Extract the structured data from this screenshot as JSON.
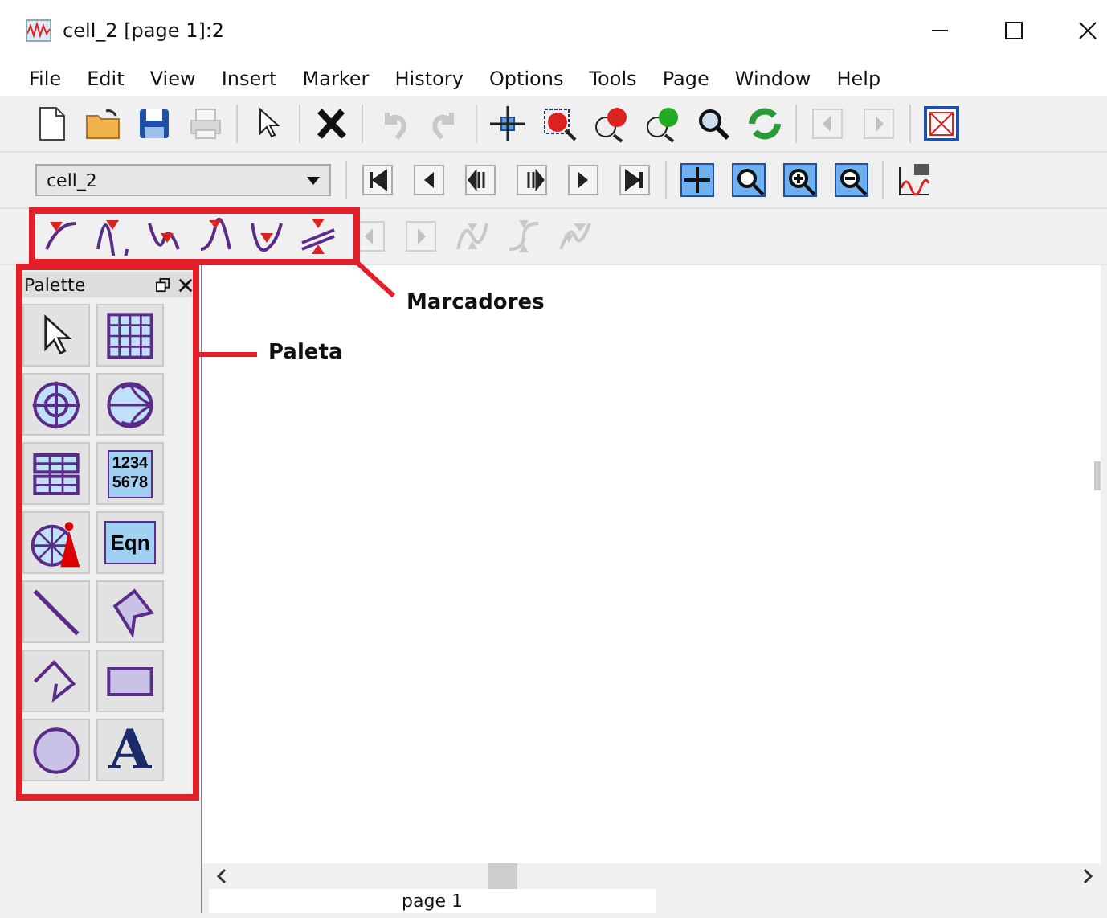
{
  "window": {
    "title": "cell_2 [page 1]:2"
  },
  "menu": [
    "File",
    "Edit",
    "View",
    "Insert",
    "Marker",
    "History",
    "Options",
    "Tools",
    "Page",
    "Window",
    "Help"
  ],
  "toolbar_main": [
    {
      "disabled": false
    },
    {
      "disabled": false
    },
    {
      "disabled": false
    },
    {
      "disabled": true
    },
    {
      "disabled": false
    },
    {
      "disabled": false
    },
    {
      "disabled": true
    },
    {
      "disabled": true
    },
    {
      "disabled": false
    },
    {
      "disabled": false
    },
    {
      "disabled": false
    },
    {
      "disabled": false
    },
    {
      "disabled": false
    },
    {
      "disabled": false
    },
    {
      "disabled": true
    },
    {
      "disabled": true
    },
    {
      "disabled": false
    }
  ],
  "toolbar_nav": {
    "cell_select": {
      "value": "cell_2"
    },
    "buttons": [
      {
        "disabled": false
      },
      {
        "disabled": false
      },
      {
        "disabled": false
      },
      {
        "disabled": false
      },
      {
        "disabled": false
      },
      {
        "disabled": false
      },
      {
        "disabled": false
      },
      {
        "disabled": false
      },
      {
        "disabled": false
      },
      {
        "disabled": false
      },
      {
        "disabled": false
      }
    ]
  },
  "toolbar_markers": [
    {
      "disabled": false
    },
    {
      "disabled": false
    },
    {
      "disabled": false
    },
    {
      "disabled": false
    },
    {
      "disabled": false
    },
    {
      "disabled": false
    },
    {
      "disabled": true
    },
    {
      "disabled": true
    },
    {
      "disabled": true
    },
    {
      "disabled": true
    },
    {
      "disabled": true
    }
  ],
  "palette": {
    "title": "Palette",
    "items": [
      {
        "kind": "icon"
      },
      {
        "kind": "icon"
      },
      {
        "kind": "icon"
      },
      {
        "kind": "icon"
      },
      {
        "kind": "icon"
      },
      {
        "kind": "numbers",
        "lines": [
          "1234",
          "5678"
        ]
      },
      {
        "kind": "icon"
      },
      {
        "kind": "label",
        "text": "Eqn"
      },
      {
        "kind": "icon"
      },
      {
        "kind": "icon"
      },
      {
        "kind": "icon"
      },
      {
        "kind": "icon"
      },
      {
        "kind": "icon"
      },
      {
        "kind": "letter",
        "text": "A"
      }
    ]
  },
  "page_tabs": [
    {
      "label": "page 1",
      "selected": true
    }
  ],
  "annotations": [
    {
      "label": "Marcadores"
    },
    {
      "label": "Paleta"
    }
  ]
}
